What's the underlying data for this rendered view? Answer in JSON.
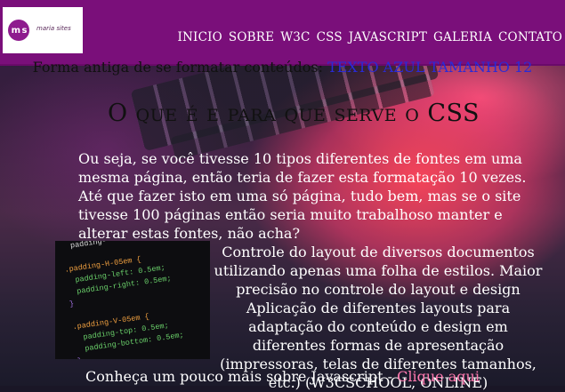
{
  "header": {
    "logo_mark": "m s",
    "logo_text": "maria sites",
    "nav": [
      "INICIO",
      "SOBRE",
      "W3C",
      "CSS",
      "JAVASCRIPT",
      "GALERIA",
      "CONTATO"
    ]
  },
  "main": {
    "legacy_prefix": "Forma antiga de se formatar conteúdos:",
    "legacy_highlight": "TEXTO AZUL TAMANHO 12",
    "title": "O que é e para que serve o CSS",
    "paragraph1": "Ou seja, se você tivesse 10 tipos diferentes de fontes em uma mesma página, então teria de fazer esta formatação 10 vezes. Até que fazer isto em uma só página, tudo bem, mas se o site tivesse 100 páginas então seria muito trabalhoso manter e alterar estas fontes, não acha?",
    "paragraph2": "Controle do layout de diversos documentos utilizando apenas uma folha de estilos. Maior precisão no controle do layout e design Aplicação de diferentes layouts para adaptação do conteúdo e design em diferentes formas de apresentação (impressoras, telas de diferentes tamanhos, etc.) (W3CSCHOOL, ONLINE)",
    "more_text": "Conheça um pouco mais sobre Javascript -",
    "more_link": "Clique aqui"
  },
  "code_image": {
    "lines": [
      "  padding-",
      "",
      ".padding-H-05em {",
      "  padding-left: 0.5em;",
      "  padding-right: 0.5em;",
      "}",
      "",
      ".padding-V-05em {",
      "  padding-top: 0.5em;",
      "  padding-bottom: 0.5em;",
      "}"
    ]
  },
  "colors": {
    "header_bg": "#7a0f7a",
    "legacy_blue": "#2a2ad8",
    "link": "#ff7ab0"
  }
}
